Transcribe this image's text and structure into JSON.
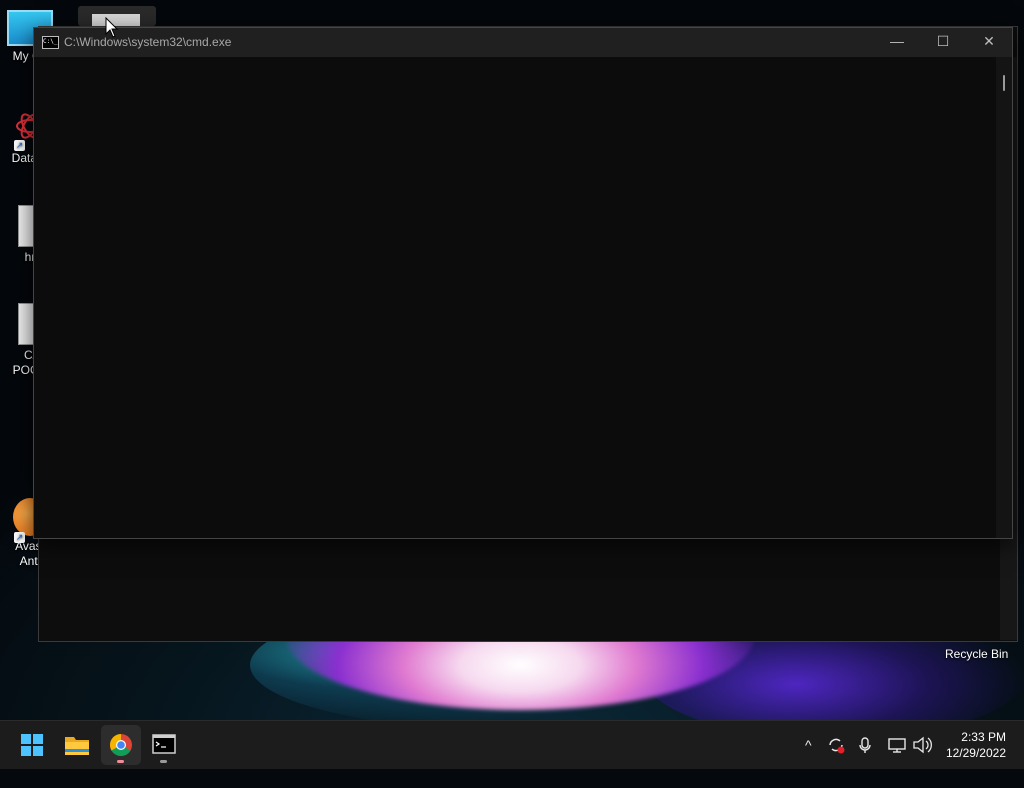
{
  "desktop": {
    "icons": [
      {
        "label": "My Co"
      },
      {
        "label": "DataW"
      },
      {
        "label": "hr"
      },
      {
        "label": "C/"
      },
      {
        "label": "POCC"
      },
      {
        "label": "Avast"
      },
      {
        "label": "Anti"
      }
    ],
    "recycle_bin_label": "Recycle Bin"
  },
  "cmd_window": {
    "title": "C:\\Windows\\system32\\cmd.exe",
    "icon_text": "C:\\_",
    "minimize_glyph": "—",
    "maximize_glyph": "☐",
    "close_glyph": "✕"
  },
  "back_window": {
    "close_glyph": "✕"
  },
  "taskbar": {
    "icon_names": [
      "windows-start-icon",
      "file-explorer-icon",
      "chrome-icon",
      "cmd-icon"
    ],
    "clock": {
      "time": "2:33 PM",
      "date": "12/29/2022"
    },
    "tray_glyphs": {
      "chevron": "^",
      "mic": "🎙",
      "speaker": "🔊"
    }
  },
  "colors": {
    "taskbar_bg": "#1c1c1c",
    "console_bg": "#0c0c0c",
    "titlebar_bg": "#202020",
    "chrome_indicator": "#f28b9a",
    "cmd_indicator": "#9a9a9a"
  }
}
